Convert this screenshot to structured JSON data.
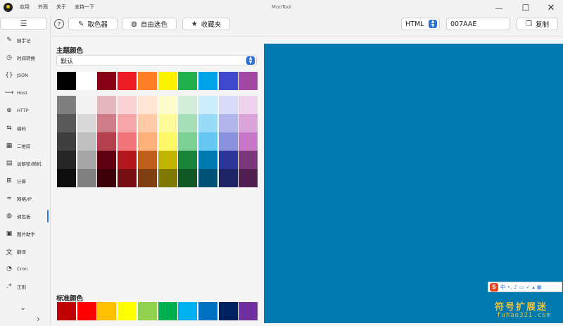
{
  "window": {
    "title": "MooTool",
    "menus": [
      "应用",
      "外观",
      "关于",
      "支持一下"
    ]
  },
  "sidebar": {
    "items": [
      {
        "label": "随手记",
        "icon": "pencil-icon",
        "glyph": "✎"
      },
      {
        "label": "时间转换",
        "icon": "clock-icon",
        "glyph": "◷"
      },
      {
        "label": "JSON",
        "icon": "braces-icon",
        "glyph": "{}"
      },
      {
        "label": "Host",
        "icon": "host-icon",
        "glyph": "⟶"
      },
      {
        "label": "HTTP",
        "icon": "globe-icon",
        "glyph": "⊕"
      },
      {
        "label": "编码",
        "icon": "encode-icon",
        "glyph": "⇆"
      },
      {
        "label": "二维码",
        "icon": "qrcode-icon",
        "glyph": "▦"
      },
      {
        "label": "加解密/随机",
        "icon": "lock-icon",
        "glyph": "▤"
      },
      {
        "label": "计算",
        "icon": "calculator-icon",
        "glyph": "⊞"
      },
      {
        "label": "网络/IP",
        "icon": "wifi-icon",
        "glyph": "≈"
      },
      {
        "label": "调色板",
        "icon": "palette-icon",
        "glyph": "◍"
      },
      {
        "label": "图片助手",
        "icon": "image-icon",
        "glyph": "▣"
      },
      {
        "label": "翻译",
        "icon": "translate-icon",
        "glyph": "文"
      },
      {
        "label": "Cron",
        "icon": "cron-icon",
        "glyph": "◔"
      },
      {
        "label": "正则",
        "icon": "regex-icon",
        "glyph": ".*"
      }
    ]
  },
  "toolbar": {
    "help_glyph": "?",
    "picker_label": "取色器",
    "free_pick_label": "自由选色",
    "favorites_label": "收藏夹",
    "format_value": "HTML",
    "hex_value": "007AAE",
    "copy_label": "复制"
  },
  "palette": {
    "theme_title": "主题颜色",
    "scheme_value": "默认",
    "standard_title": "标准颜色",
    "base_colors": [
      "#000000",
      "#ffffff",
      "#860016",
      "#ec1d25",
      "#ff7e26",
      "#fef200",
      "#23b14d",
      "#00a3e8",
      "#3f47cc",
      "#a349a3"
    ],
    "shade_columns": [
      [
        "#7f7f7f",
        "#595959",
        "#3f3f3f",
        "#262626",
        "#0d0d0d"
      ],
      [
        "#f2f2f2",
        "#d9d9d9",
        "#bfbfbf",
        "#a6a6a6",
        "#808080"
      ],
      [
        "#e5b8c0",
        "#cf7c89",
        "#b4404f",
        "#5f0010",
        "#3c000a"
      ],
      [
        "#fad2d3",
        "#f5a4a7",
        "#f0767b",
        "#b1161c",
        "#760f12"
      ],
      [
        "#ffe5d3",
        "#ffcba8",
        "#ffb17c",
        "#bf5e1c",
        "#7f3f13"
      ],
      [
        "#fefccc",
        "#fefa99",
        "#fef766",
        "#bfb500",
        "#7f7900"
      ],
      [
        "#d3efdb",
        "#a7e0b8",
        "#7bd094",
        "#1a853a",
        "#125827"
      ],
      [
        "#ccedfa",
        "#99daf6",
        "#66c8f1",
        "#007aae",
        "#005274"
      ],
      [
        "#d9dafa",
        "#b2b5eb",
        "#8c91e0",
        "#2f3599",
        "#1f2366"
      ],
      [
        "#edd1ed",
        "#daa4da",
        "#c876c8",
        "#7a377a",
        "#521f52"
      ]
    ],
    "standard_colors": [
      "#c00000",
      "#ff0000",
      "#ffc000",
      "#ffff00",
      "#92d050",
      "#00b050",
      "#00b0f0",
      "#0070c0",
      "#002060",
      "#7030a0"
    ]
  },
  "preview": {
    "color": "#007AAE"
  },
  "watermark": {
    "ime_label": "中",
    "title": "符号扩展迷",
    "url": "fuhao321.com"
  },
  "colors": {
    "accent": "#2a6fd6",
    "active_indicator": "#2a7be4"
  }
}
